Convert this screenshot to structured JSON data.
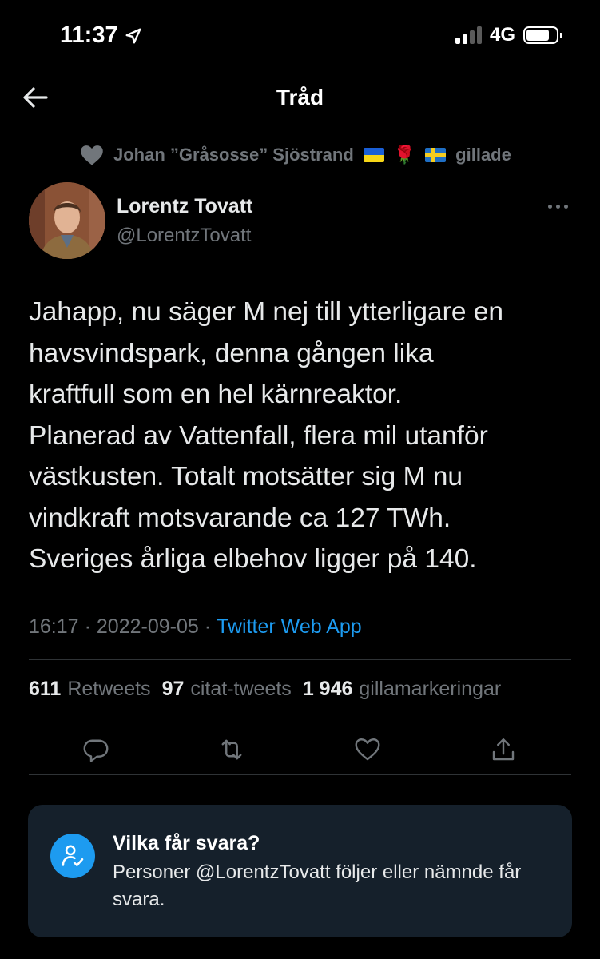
{
  "status_bar": {
    "time": "11:37",
    "network": "4G"
  },
  "nav": {
    "title": "Tråd"
  },
  "social_context": {
    "name": "Johan ”Gråsosse” Sjöstrand",
    "action": "gillade",
    "rose": "🌹"
  },
  "tweet": {
    "author_name": "Lorentz Tovatt",
    "author_handle": "@LorentzTovatt",
    "text": "Jahapp, nu säger M nej till ytterligare en\nhavsvindspark, denna gången lika\nkraftfull som en hel kärnreaktor.\nPlanerad av Vattenfall, flera mil utanför\nvästkusten. Totalt motsätter sig M nu\nvindkraft motsvarande ca 127 TWh.\nSveriges årliga elbehov ligger på 140.",
    "time": "16:17",
    "sep": "·",
    "date": "2022-09-05",
    "source": "Twitter Web App"
  },
  "stats": {
    "retweets_count": "611",
    "retweets_label": "Retweets",
    "quotes_count": "97",
    "quotes_label": "citat-tweets",
    "likes_count": "1 946",
    "likes_label": "gillamarkeringar"
  },
  "reply_card": {
    "title": "Vilka får svara?",
    "body": "Personer @LorentzTovatt följer eller nämnde får svara."
  },
  "icons": {
    "liked": "heart-icon",
    "reply": "reply-icon",
    "retweet": "retweet-icon",
    "like": "like-icon",
    "share": "share-icon"
  },
  "colors": {
    "background": "#000000",
    "secondary_text": "#71767b",
    "link": "#1d9bf0",
    "card": "#15202b"
  }
}
